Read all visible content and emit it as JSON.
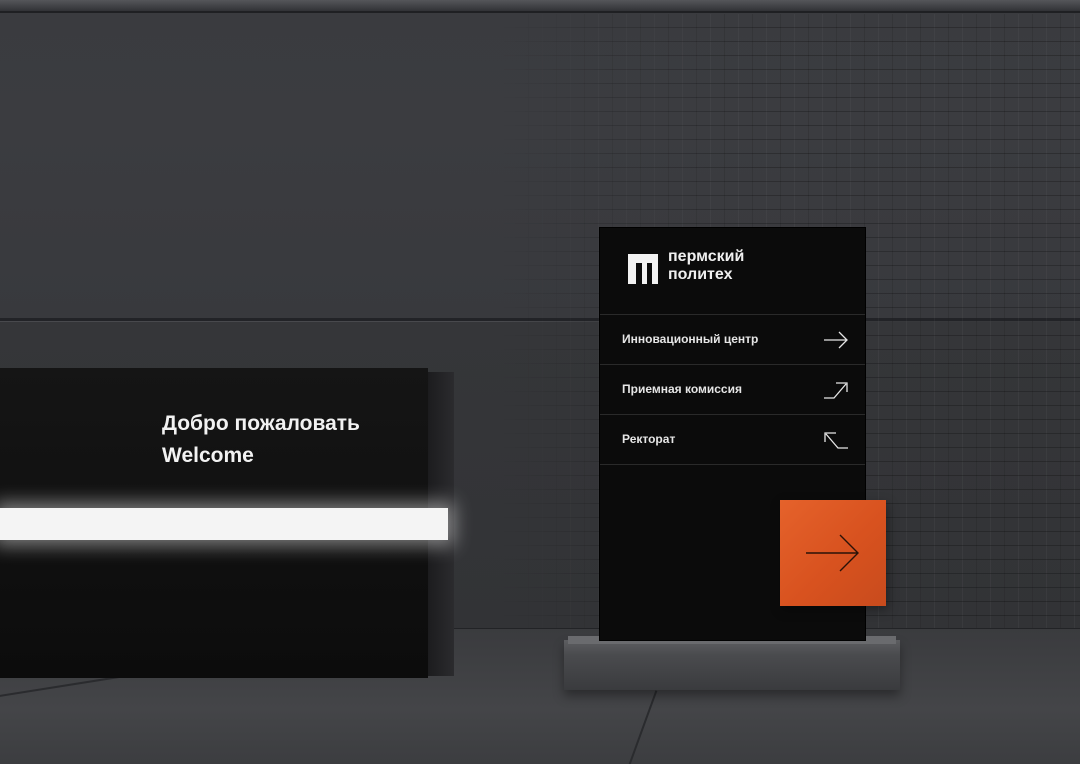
{
  "welcome": {
    "line1": "Добро пожаловать",
    "line2": "Welcome"
  },
  "sign": {
    "logo_line1": "пермский",
    "logo_line2": "политех",
    "logo_icon": "pi-logo-icon",
    "directions": [
      {
        "label": "Инновационный центр",
        "icon": "arrow-right-icon"
      },
      {
        "label": "Приемная комиссия",
        "icon": "arrow-up-right-icon"
      },
      {
        "label": "Ректорат",
        "icon": "arrow-up-left-icon"
      }
    ],
    "tile_icon": "arrow-right-icon"
  },
  "colors": {
    "accent": "#e05a26",
    "sign_bg": "#0b0b0b",
    "wall": "#38393d",
    "glow": "#f4f4f4"
  }
}
